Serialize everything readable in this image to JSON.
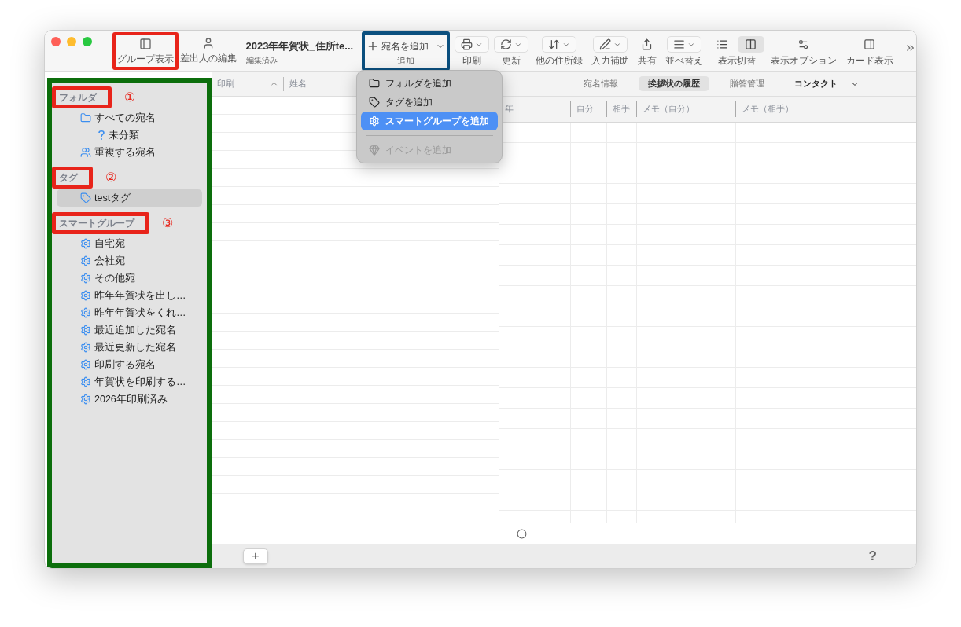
{
  "window": {
    "title": "2023年年賀状_住所te...",
    "subtitle": "編集済み"
  },
  "toolbar": {
    "left": [
      {
        "label": "グループ表示"
      },
      {
        "label": "差出人の編集"
      }
    ],
    "add_button": {
      "label": "宛名を追加",
      "caption": "追加"
    },
    "items": [
      {
        "label": "印刷",
        "kind": "dropdown"
      },
      {
        "label": "更新",
        "kind": "dropdown"
      },
      {
        "label": "他の住所録",
        "kind": "dropdown"
      },
      {
        "label": "入力補助",
        "kind": "dropdown"
      },
      {
        "label": "共有",
        "kind": "plain"
      },
      {
        "label": "並べ替え",
        "kind": "dropdown"
      },
      {
        "label": "表示切替",
        "kind": "segmented",
        "segments": [
          {
            "selected": false
          },
          {
            "selected": true
          }
        ]
      },
      {
        "label": "表示オプション",
        "kind": "plain"
      },
      {
        "label": "カード表示",
        "kind": "plain"
      }
    ]
  },
  "add_menu": [
    [
      {
        "label": "フォルダを追加",
        "kind": "folder",
        "selected": false,
        "disabled": false
      },
      {
        "label": "タグを追加",
        "kind": "tag",
        "selected": false,
        "disabled": false
      },
      {
        "label": "スマートグループを追加",
        "kind": "smart",
        "selected": true,
        "disabled": false
      }
    ],
    [
      {
        "label": "イベントを追加",
        "kind": "event",
        "selected": false,
        "disabled": true
      }
    ]
  ],
  "sidebar": {
    "sections": [
      {
        "title": "フォルダ",
        "items": [
          {
            "label": "すべての宛名",
            "kind": "folder",
            "selected": false,
            "children": [
              {
                "label": "未分類",
                "kind": "unfiled",
                "selected": false
              }
            ]
          },
          {
            "label": "重複する宛名",
            "kind": "duplicates",
            "selected": false
          }
        ]
      },
      {
        "title": "タグ",
        "items": [
          {
            "label": "testタグ",
            "kind": "tag",
            "selected": true
          }
        ]
      },
      {
        "title": "スマートグループ",
        "items": [
          {
            "label": "自宅宛",
            "kind": "smart",
            "selected": false
          },
          {
            "label": "会社宛",
            "kind": "smart",
            "selected": false
          },
          {
            "label": "その他宛",
            "kind": "smart",
            "selected": false
          },
          {
            "label": "昨年年賀状を出し…",
            "kind": "smart",
            "selected": false
          },
          {
            "label": "昨年年賀状をくれ…",
            "kind": "smart",
            "selected": false
          },
          {
            "label": "最近追加した宛名",
            "kind": "smart",
            "selected": false
          },
          {
            "label": "最近更新した宛名",
            "kind": "smart",
            "selected": false
          },
          {
            "label": "印刷する宛名",
            "kind": "smart",
            "selected": false
          },
          {
            "label": "年賀状を印刷する…",
            "kind": "smart",
            "selected": false
          },
          {
            "label": "2026年印刷済み",
            "kind": "smart",
            "selected": false
          }
        ]
      }
    ]
  },
  "list": {
    "columns": [
      {
        "label": "印刷",
        "sorted": true
      },
      {
        "label": "姓名",
        "sorted": false
      }
    ]
  },
  "detail": {
    "tabs": [
      {
        "label": "宛名情報",
        "kind": "tab",
        "selected": false
      },
      {
        "label": "挨拶状の履歴",
        "kind": "tab",
        "selected": true
      },
      {
        "label": "贈答管理",
        "kind": "tab",
        "selected": false
      },
      {
        "label": "コンタクト",
        "kind": "dropdown",
        "selected": false
      }
    ],
    "columns": [
      "年",
      "自分",
      "相手",
      "メモ（自分）",
      "メモ（相手）"
    ]
  },
  "footer": {
    "add": "+",
    "help": "?"
  },
  "annotations": {
    "boxes": [
      {
        "color": "#e8241a"
      },
      {
        "color": "#0b4f7e"
      },
      {
        "color": "#0c6e0c"
      },
      {
        "color": "#e8241a"
      },
      {
        "color": "#e8241a"
      },
      {
        "color": "#e8241a"
      }
    ],
    "markers": [
      "①",
      "②",
      "③"
    ]
  }
}
